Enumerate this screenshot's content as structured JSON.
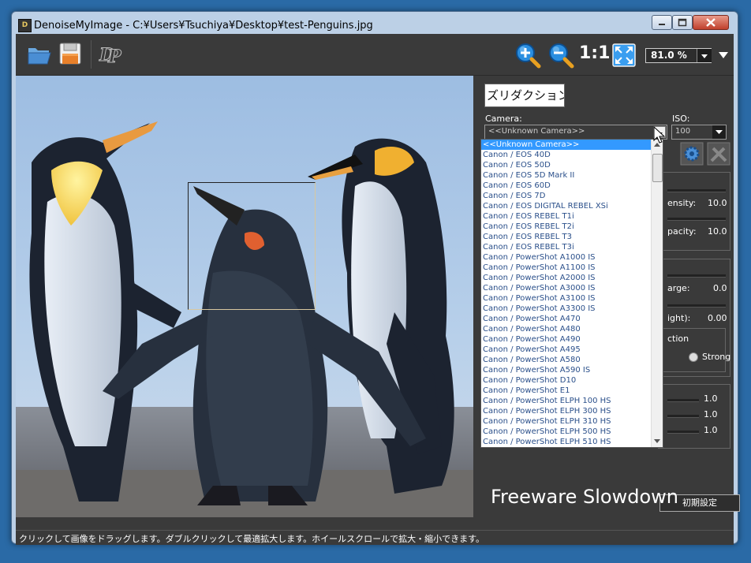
{
  "window": {
    "title": "DenoiseMyImage - C:¥Users¥Tsuchiya¥Desktop¥test-Penguins.jpg",
    "app_icon_text": "D"
  },
  "toolbar": {
    "zoom_value": "81.0 %",
    "one_to_one_label": "1:1"
  },
  "panel": {
    "noise_reduction_button": "ズリダクション",
    "camera_label": "Camera:",
    "camera_value": "<<Unknown Camera>>",
    "iso_label": "ISO:",
    "iso_value": "100",
    "density_label": "ensity:",
    "density_value": "10.0",
    "opacity_label": "pacity:",
    "opacity_value": "10.0",
    "large_label": "arge:",
    "large_value": "0.0",
    "light_label": "ight):",
    "light_value": "0.00",
    "correction_label": "ction",
    "strong_label": "Strong",
    "rgb_values": [
      "1.0",
      "1.0",
      "1.0"
    ],
    "reset_button": "初期設定"
  },
  "camera_dropdown": {
    "items": [
      "<<Unknown Camera>>",
      "Canon / EOS 40D",
      "Canon / EOS 50D",
      "Canon / EOS 5D Mark II",
      "Canon / EOS 60D",
      "Canon / EOS 7D",
      "Canon / EOS DIGITAL REBEL XSi",
      "Canon / EOS REBEL T1i",
      "Canon / EOS REBEL T2i",
      "Canon / EOS REBEL T3",
      "Canon / EOS REBEL T3i",
      "Canon / PowerShot A1000 IS",
      "Canon / PowerShot A1100 IS",
      "Canon / PowerShot A2000 IS",
      "Canon / PowerShot A3000 IS",
      "Canon / PowerShot A3100 IS",
      "Canon / PowerShot A3300 IS",
      "Canon / PowerShot A470",
      "Canon / PowerShot A480",
      "Canon / PowerShot A490",
      "Canon / PowerShot A495",
      "Canon / PowerShot A580",
      "Canon / PowerShot A590 IS",
      "Canon / PowerShot D10",
      "Canon / PowerShot E1",
      "Canon / PowerShot ELPH 100 HS",
      "Canon / PowerShot ELPH 300 HS",
      "Canon / PowerShot ELPH 310 HS",
      "Canon / PowerShot ELPH 500 HS",
      "Canon / PowerShot ELPH 510 HS"
    ],
    "selected": 0
  },
  "watermark": "Freeware Slowdown",
  "status_text": "クリックして画像をドラッグします。ダブルクリックして最適拡大します。ホイールスクロールで拡大・縮小できます。",
  "colors": {
    "desktop": "#2a6aa6",
    "panel_bg": "#3a3a3a",
    "selection": "#3399ff",
    "list_text": "#2a4f8a"
  }
}
